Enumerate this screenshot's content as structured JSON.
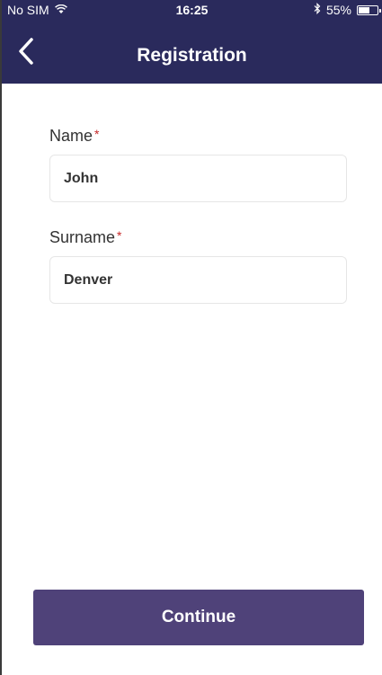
{
  "status_bar": {
    "carrier": "No SIM",
    "time": "16:25",
    "battery_percent": "55%",
    "battery_level": 0.55,
    "wifi_icon": "wifi-icon",
    "bluetooth_icon": "bluetooth-icon"
  },
  "nav": {
    "title": "Registration",
    "back_icon": "chevron-left-icon"
  },
  "form": {
    "name": {
      "label": "Name",
      "required_mark": "*",
      "value": "John"
    },
    "surname": {
      "label": "Surname",
      "required_mark": "*",
      "value": "Denver"
    }
  },
  "actions": {
    "continue_label": "Continue"
  },
  "colors": {
    "header_bg": "#2a2a5c",
    "button_bg": "#4f4279",
    "required": "#c62828"
  }
}
